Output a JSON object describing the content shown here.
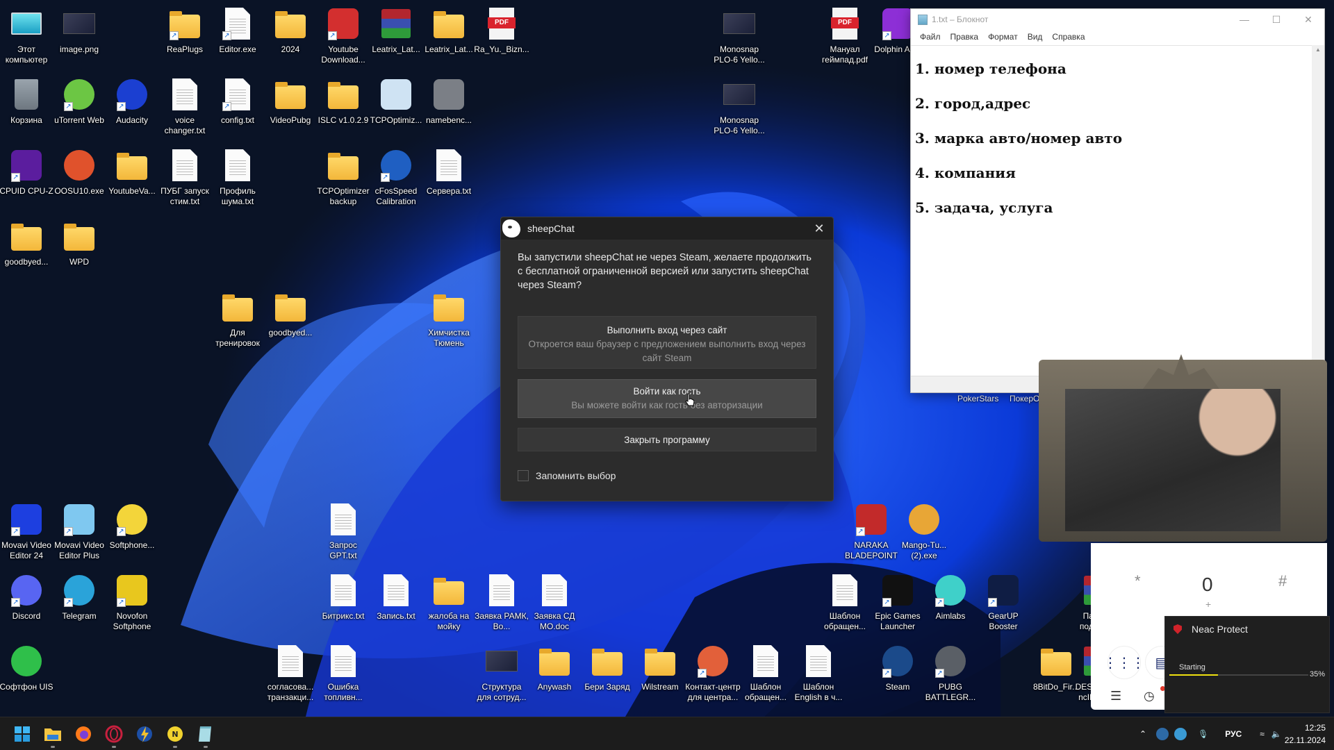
{
  "desktop": {
    "icons": [
      {
        "label": "Этот компьютер",
        "icon": "this-pc-icon",
        "kind": "monitor",
        "col": 0,
        "row": 0
      },
      {
        "label": "image.png",
        "icon": "image-file-icon",
        "kind": "thumb",
        "col": 1,
        "row": 0
      },
      {
        "label": "ReaPlugs",
        "icon": "folder-icon",
        "kind": "folder",
        "col": 3,
        "row": 0,
        "shortcut": true
      },
      {
        "label": "Editor.exe",
        "icon": "notepad-editor-icon",
        "kind": "doc",
        "col": 4,
        "row": 0,
        "shortcut": true
      },
      {
        "label": "2024",
        "icon": "folder-icon",
        "kind": "folder",
        "col": 5,
        "row": 0
      },
      {
        "label": "Youtube Download...",
        "icon": "youtube-downloader-icon",
        "kind": "square",
        "color": "#d32f2f",
        "col": 6,
        "row": 0,
        "shortcut": true
      },
      {
        "label": "Leatrix_Lat...",
        "icon": "winrar-archive-icon",
        "kind": "rar",
        "col": 7,
        "row": 0
      },
      {
        "label": "Leatrix_Lat...",
        "icon": "folder-icon",
        "kind": "folder",
        "col": 8,
        "row": 0
      },
      {
        "label": "Ra_Yu._Bizn...",
        "icon": "pdf-file-icon",
        "kind": "pdf",
        "col": 9,
        "row": 0
      },
      {
        "label": "Monosnap PLO-6 Yello...",
        "icon": "image-file-icon",
        "kind": "thumb",
        "col": 13.5,
        "row": 0
      },
      {
        "label": "Мануал геймпад.pdf",
        "icon": "pdf-file-icon",
        "kind": "pdf",
        "col": 15.5,
        "row": 0
      },
      {
        "label": "Dolphin Anty",
        "icon": "dolphin-anty-icon",
        "kind": "square",
        "color": "#8d2fd6",
        "col": 16.5,
        "row": 0,
        "shortcut": true
      },
      {
        "label": "Корзина",
        "icon": "recycle-bin-icon",
        "kind": "bin",
        "col": 0,
        "row": 1
      },
      {
        "label": "uTorrent Web",
        "icon": "utorrent-icon",
        "kind": "round",
        "color": "#6cc644",
        "col": 1,
        "row": 1,
        "shortcut": true
      },
      {
        "label": "Audacity",
        "icon": "audacity-icon",
        "kind": "round",
        "color": "#1b3fd1",
        "col": 2,
        "row": 1,
        "shortcut": true
      },
      {
        "label": "voice changer.txt",
        "icon": "text-file-icon",
        "kind": "doc",
        "col": 3,
        "row": 1
      },
      {
        "label": "config.txt",
        "icon": "text-file-icon",
        "kind": "doc",
        "col": 4,
        "row": 1,
        "shortcut": true
      },
      {
        "label": "VideoPubg",
        "icon": "folder-icon",
        "kind": "folder",
        "col": 5,
        "row": 1
      },
      {
        "label": "ISLC v1.0.2.9",
        "icon": "folder-icon",
        "kind": "folder",
        "col": 6,
        "row": 1
      },
      {
        "label": "TCPOptimiz...",
        "icon": "tcpoptimizer-icon",
        "kind": "square",
        "color": "#cfe3f3",
        "col": 7,
        "row": 1
      },
      {
        "label": "namebenc...",
        "icon": "namebench-icon",
        "kind": "square",
        "color": "#7b7f86",
        "col": 8,
        "row": 1
      },
      {
        "label": "Monosnap PLO-6 Yello...",
        "icon": "image-file-icon",
        "kind": "thumb",
        "col": 13.5,
        "row": 1
      },
      {
        "label": "CPUID CPU-Z",
        "icon": "cpuz-icon",
        "kind": "square",
        "color": "#5b1d9e",
        "col": 0,
        "row": 2,
        "shortcut": true
      },
      {
        "label": "OOSU10.exe",
        "icon": "oosu-icon",
        "kind": "round",
        "color": "#e0522c",
        "col": 1,
        "row": 2
      },
      {
        "label": "YoutubeVa...",
        "icon": "folder-icon",
        "kind": "folder",
        "col": 2,
        "row": 2
      },
      {
        "label": "ПУБГ запуск стим.txt",
        "icon": "text-file-icon",
        "kind": "doc",
        "col": 3,
        "row": 2
      },
      {
        "label": "Профиль шума.txt",
        "icon": "text-file-icon",
        "kind": "doc",
        "col": 4,
        "row": 2
      },
      {
        "label": "TCPOptimizer backup",
        "icon": "folder-icon",
        "kind": "folder",
        "col": 6,
        "row": 2
      },
      {
        "label": "cFosSpeed Calibration",
        "icon": "cfosspeed-icon",
        "kind": "round",
        "color": "#1f5fc2",
        "col": 7,
        "row": 2,
        "shortcut": true
      },
      {
        "label": "Сервера.txt",
        "icon": "text-file-icon",
        "kind": "doc",
        "col": 8,
        "row": 2
      },
      {
        "label": "goodbyed...",
        "icon": "folder-icon",
        "kind": "folder",
        "col": 0,
        "row": 3
      },
      {
        "label": "WPD",
        "icon": "folder-icon",
        "kind": "folder",
        "col": 1,
        "row": 3
      },
      {
        "label": "Для тренировок",
        "icon": "folder-icon",
        "kind": "folder",
        "col": 4,
        "row": 4
      },
      {
        "label": "goodbyed...",
        "icon": "folder-icon",
        "kind": "folder",
        "col": 5,
        "row": 4
      },
      {
        "label": "Химчистка Тюмень",
        "icon": "folder-icon",
        "kind": "folder",
        "col": 8,
        "row": 4
      },
      {
        "label": "Movavi Video Editor 24",
        "icon": "movavi-icon",
        "kind": "square",
        "color": "#1d3fe0",
        "col": 0,
        "row": 7,
        "shortcut": true
      },
      {
        "label": "Movavi Video Editor Plus",
        "icon": "movavi-plus-icon",
        "kind": "square",
        "color": "#7fc8f0",
        "col": 1,
        "row": 7,
        "shortcut": true
      },
      {
        "label": "Softphone...",
        "icon": "softphone-icon",
        "kind": "round",
        "color": "#f3d53a",
        "col": 2,
        "row": 7,
        "shortcut": true
      },
      {
        "label": "Запрос GPT.txt",
        "icon": "text-file-icon",
        "kind": "doc",
        "col": 6,
        "row": 7
      },
      {
        "label": "NARAKA BLADEPOINT",
        "icon": "naraka-icon",
        "kind": "square",
        "color": "#c22a2a",
        "col": 16,
        "row": 7,
        "shortcut": true
      },
      {
        "label": "Mango-Tu... (2).exe",
        "icon": "mango-tuner-icon",
        "kind": "round",
        "color": "#e8a636",
        "col": 17,
        "row": 7
      },
      {
        "label": "Discord",
        "icon": "discord-icon",
        "kind": "round",
        "color": "#5865f2",
        "col": 0,
        "row": 8,
        "shortcut": true
      },
      {
        "label": "Telegram",
        "icon": "telegram-icon",
        "kind": "round",
        "color": "#2aa3d9",
        "col": 1,
        "row": 8,
        "shortcut": true
      },
      {
        "label": "Novofon Softphone",
        "icon": "novofon-icon",
        "kind": "square",
        "color": "#e8c71e",
        "col": 2,
        "row": 8,
        "shortcut": true
      },
      {
        "label": "Битрикс.txt",
        "icon": "text-file-icon",
        "kind": "doc",
        "col": 6,
        "row": 8
      },
      {
        "label": "Запись.txt",
        "icon": "text-file-icon",
        "kind": "doc",
        "col": 7,
        "row": 8
      },
      {
        "label": "жалоба на мойку",
        "icon": "folder-icon",
        "kind": "folder",
        "col": 8,
        "row": 8
      },
      {
        "label": "Заявка РАМК, Во...",
        "icon": "word-doc-icon",
        "kind": "doc",
        "col": 9,
        "row": 8
      },
      {
        "label": "Заявка СД МО.doc",
        "icon": "word-doc-icon",
        "kind": "doc",
        "col": 10,
        "row": 8
      },
      {
        "label": "Шаблон обращен...",
        "icon": "text-file-icon",
        "kind": "doc",
        "col": 15.5,
        "row": 8
      },
      {
        "label": "Epic Games Launcher",
        "icon": "epic-games-icon",
        "kind": "square",
        "color": "#111111",
        "col": 16.5,
        "row": 8,
        "shortcut": true
      },
      {
        "label": "Aimlabs",
        "icon": "aimlabs-icon",
        "kind": "round",
        "color": "#3fd0c9",
        "col": 17.5,
        "row": 8,
        "shortcut": true
      },
      {
        "label": "GearUP Booster",
        "icon": "gearup-icon",
        "kind": "square",
        "color": "#0f1d44",
        "col": 18.5,
        "row": 8,
        "shortcut": true
      },
      {
        "label": "Пак для подният...",
        "icon": "winrar-archive-icon",
        "kind": "rar",
        "col": 20.3,
        "row": 8
      },
      {
        "label": "Софтфон UIS",
        "icon": "softphone-uis-icon",
        "kind": "round",
        "color": "#2fbf4a",
        "col": 0,
        "row": 9
      },
      {
        "label": "согласова... транзакци...",
        "icon": "text-file-icon",
        "kind": "doc",
        "col": 5,
        "row": 9
      },
      {
        "label": "Ошибка топливн...",
        "icon": "text-file-icon",
        "kind": "doc",
        "col": 6,
        "row": 9
      },
      {
        "label": "Структура для сотруд...",
        "icon": "image-file-icon",
        "kind": "thumb",
        "col": 9,
        "row": 9
      },
      {
        "label": "Anywash",
        "icon": "folder-icon",
        "kind": "folder",
        "col": 10,
        "row": 9
      },
      {
        "label": "Бери Заряд",
        "icon": "folder-icon",
        "kind": "folder",
        "col": 11,
        "row": 9
      },
      {
        "label": "Wilstream",
        "icon": "folder-icon",
        "kind": "folder",
        "col": 12,
        "row": 9
      },
      {
        "label": "Контакт-центр для центра...",
        "icon": "contact-center-icon",
        "kind": "round",
        "color": "#e2603a",
        "col": 13,
        "row": 9,
        "shortcut": true
      },
      {
        "label": "Шаблон обращен...",
        "icon": "text-file-icon",
        "kind": "doc",
        "col": 14,
        "row": 9
      },
      {
        "label": "Шаблон English в ч...",
        "icon": "text-file-icon",
        "kind": "doc",
        "col": 15,
        "row": 9
      },
      {
        "label": "Steam",
        "icon": "steam-icon",
        "kind": "round",
        "color": "#1b4a8a",
        "col": 16.5,
        "row": 9,
        "shortcut": true
      },
      {
        "label": "PUBG BATTLEGR...",
        "icon": "pubg-icon",
        "kind": "round",
        "color": "#5a5f66",
        "col": 17.5,
        "row": 9,
        "shortcut": true
      },
      {
        "label": "8BitDo_Fir...",
        "icon": "folder-icon",
        "kind": "folder",
        "col": 19.5,
        "row": 9
      },
      {
        "label": "DESTROY... ncINPUT...",
        "icon": "winrar-archive-icon",
        "kind": "rar",
        "col": 20.3,
        "row": 9
      }
    ],
    "poker_labels": [
      "PokerStars",
      "ПокерОК"
    ]
  },
  "notepad": {
    "title": "1.txt – Блокнот",
    "menu": [
      "Файл",
      "Правка",
      "Формат",
      "Вид",
      "Справка"
    ],
    "lines": [
      "1. номер телефона",
      "2. город,адрес",
      "3. марка авто/номер авто",
      "4. компания",
      "5. задача, услуга"
    ]
  },
  "dialog": {
    "title": "sheepChat",
    "prompt": "Вы запустили sheepChat не через Steam, желаете продолжить с бесплатной ограниченной версией или запустить sheepChat через Steam?",
    "buttons": {
      "site": {
        "title": "Выполнить вход через сайт",
        "subtitle": "Откроется ваш браузер с предложением выполнить вход через сайт Steam"
      },
      "guest": {
        "title": "Войти как гость",
        "subtitle": "Вы можете войти как гость без авторизации"
      },
      "close": {
        "title": "Закрыть программу"
      }
    },
    "remember_label": "Запомнить выбор",
    "remember_checked": false
  },
  "softphone": {
    "keys": {
      "star": "*",
      "zero": "0",
      "zero_sub": "+",
      "hash": "#"
    }
  },
  "neac_toast": {
    "title": "Neac Protect",
    "status": "Starting",
    "progress_percent": 35,
    "progress_label": "35%",
    "accent": "#f0e010"
  },
  "taskbar": {
    "apps": [
      {
        "name": "start-button",
        "icon": "windows-logo-icon"
      },
      {
        "name": "file-explorer",
        "icon": "folder-icon"
      },
      {
        "name": "firefox",
        "icon": "firefox-icon"
      },
      {
        "name": "opera-gx",
        "icon": "opera-icon"
      },
      {
        "name": "lightning-app",
        "icon": "lightning-icon"
      },
      {
        "name": "novofon",
        "icon": "novofon-icon"
      },
      {
        "name": "notepad",
        "icon": "notepad-icon"
      }
    ],
    "tray": {
      "language": "РУС",
      "time": "12:25",
      "date": "22.11.2024"
    }
  }
}
